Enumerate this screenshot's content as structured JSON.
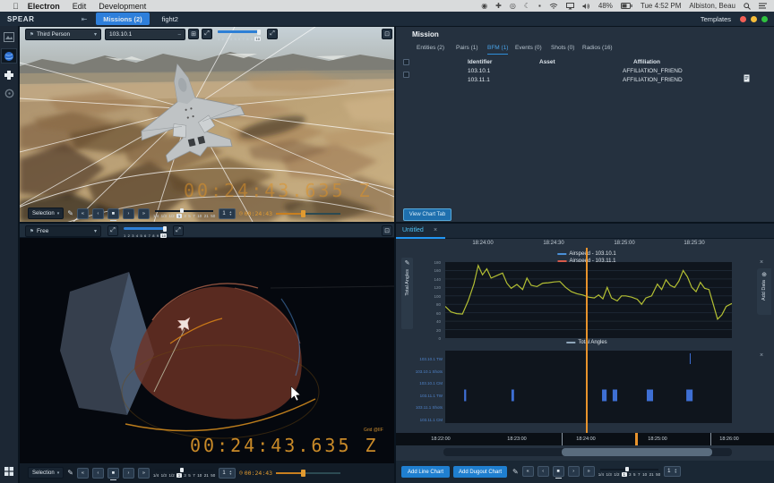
{
  "menubar": {
    "apple_logo": "",
    "menus": [
      "Electron",
      "Edit",
      "Development"
    ],
    "status": {
      "battery": "48%",
      "clock": "Tue 4:52 PM",
      "user": "Albiston, Beau"
    },
    "status_icon_names": [
      "record-icon",
      "ship-icon",
      "globe-icon",
      "moon-icon",
      "lock-icon",
      "wifi-icon",
      "airplay-icon",
      "volume-icon"
    ]
  },
  "toolbar": {
    "app_name": "SPEAR",
    "tabs": [
      {
        "label": "Missions (2)",
        "active": true
      },
      {
        "label": "fight2",
        "active": false
      }
    ],
    "templates_label": "Templates"
  },
  "sidebar": {
    "icons": [
      "scene-icon",
      "globe-3d-icon",
      "dp-logo-icon",
      "ring-icon"
    ],
    "bottom_icon": "layout-grid-icon"
  },
  "viewport_top": {
    "camera_mode": "Third Person",
    "entity": "103.10.1",
    "lod_levels": [
      "1",
      "2",
      "3",
      "4",
      "5",
      "6",
      "7",
      "8",
      "9",
      "10"
    ],
    "lod_selected": "10",
    "timestamp": "00:24:43.635 Z"
  },
  "viewport_bottom": {
    "camera_mode": "Free",
    "lod_levels": [
      "1",
      "2",
      "3",
      "4",
      "5",
      "6",
      "7",
      "8",
      "9",
      "10"
    ],
    "lod_selected": "10",
    "grid_label": "Grid @IIF",
    "timestamp": "00:24:43.635 Z"
  },
  "transport": {
    "selection_label": "Selection",
    "speeds": [
      "1/4",
      "1/3",
      "1/2",
      "1",
      "3",
      "5",
      "7",
      "10",
      "21",
      "50"
    ],
    "speed_selected": "1",
    "stepper_value": "1",
    "time": "00:24:43"
  },
  "mission": {
    "title": "Mission",
    "tabs": [
      {
        "label": "Entities (2)",
        "active": false
      },
      {
        "label": "Pairs (1)",
        "active": false
      },
      {
        "label": "BFM (1)",
        "active": true
      },
      {
        "label": "Events (0)",
        "active": false
      },
      {
        "label": "Shots (0)",
        "active": false
      },
      {
        "label": "Radios (16)",
        "active": false
      }
    ],
    "columns": [
      "Identifier",
      "Asset",
      "Affiliation"
    ],
    "rows": [
      {
        "identifier": "103.10.1",
        "asset": "",
        "affiliation": "AFFILIATION_FRIEND"
      },
      {
        "identifier": "103.11.1",
        "asset": "",
        "affiliation": "AFFILIATION_FRIEND"
      }
    ],
    "view_chart_tab_label": "View Chart Tab"
  },
  "charts": {
    "tab_label": "Untitled",
    "add_data_label": "Add Data",
    "buttons": [
      "Add Line Chart",
      "Add Dugout Chart"
    ],
    "top_time_labels": [
      "18:24:00",
      "18:24:30",
      "18:25:00",
      "18:25:30"
    ],
    "ruler_time_labels": [
      "18:22:00",
      "18:23:00",
      "18:24:00",
      "18:25:00",
      "18:26:00"
    ],
    "legend_top": [
      {
        "label": "Airspeed - 103.10.1",
        "color": "#4a90d8"
      },
      {
        "label": "Airspeed - 103.11.1",
        "color": "#d85a4a"
      }
    ],
    "legend_bottom": {
      "label": "Total Angles",
      "color": "#8fa6ba"
    },
    "y_axis_label": "Total Angles"
  },
  "chart_data": [
    {
      "type": "line",
      "title": "Total Angles",
      "ylabel": "Total Angles",
      "ylim": [
        0,
        180
      ],
      "yticks": [
        0,
        20,
        40,
        60,
        80,
        100,
        120,
        140,
        160,
        180
      ],
      "x_window": [
        "18:23:42",
        "18:25:46"
      ],
      "cursor_time": "18:24:44",
      "cursor_fraction": 0.494,
      "series": [
        {
          "name": "Total Angles",
          "color": "#b3bf33",
          "points": [
            [
              0,
              75
            ],
            [
              0.02,
              62
            ],
            [
              0.04,
              58
            ],
            [
              0.06,
              57
            ],
            [
              0.08,
              88
            ],
            [
              0.1,
              128
            ],
            [
              0.115,
              172
            ],
            [
              0.13,
              150
            ],
            [
              0.145,
              164
            ],
            [
              0.16,
              142
            ],
            [
              0.18,
              148
            ],
            [
              0.2,
              154
            ],
            [
              0.215,
              130
            ],
            [
              0.23,
              118
            ],
            [
              0.25,
              127
            ],
            [
              0.27,
              115
            ],
            [
              0.285,
              142
            ],
            [
              0.3,
              125
            ],
            [
              0.32,
              122
            ],
            [
              0.34,
              130
            ],
            [
              0.36,
              131
            ],
            [
              0.38,
              133
            ],
            [
              0.4,
              134
            ],
            [
              0.42,
              120
            ],
            [
              0.44,
              110
            ],
            [
              0.46,
              105
            ],
            [
              0.48,
              102
            ],
            [
              0.5,
              97
            ],
            [
              0.52,
              95
            ],
            [
              0.535,
              102
            ],
            [
              0.55,
              93
            ],
            [
              0.565,
              120
            ],
            [
              0.58,
              95
            ],
            [
              0.6,
              88
            ],
            [
              0.615,
              100
            ],
            [
              0.63,
              100
            ],
            [
              0.65,
              97
            ],
            [
              0.67,
              92
            ],
            [
              0.685,
              80
            ],
            [
              0.7,
              95
            ],
            [
              0.72,
              100
            ],
            [
              0.74,
              128
            ],
            [
              0.755,
              115
            ],
            [
              0.77,
              138
            ],
            [
              0.785,
              125
            ],
            [
              0.8,
              120
            ],
            [
              0.815,
              135
            ],
            [
              0.83,
              160
            ],
            [
              0.845,
              145
            ],
            [
              0.86,
              120
            ],
            [
              0.875,
              110
            ],
            [
              0.89,
              132
            ],
            [
              0.905,
              118
            ],
            [
              0.92,
              115
            ],
            [
              0.935,
              80
            ],
            [
              0.95,
              45
            ],
            [
              0.965,
              55
            ],
            [
              0.98,
              75
            ],
            [
              1,
              82
            ]
          ]
        }
      ]
    },
    {
      "type": "timeline",
      "rows": [
        "103.10.1 TW",
        "103.10.1 Shots",
        "103.10.1 CM",
        "103.11.1 TW",
        "103.11.1 Shots",
        "103.11.1 CM"
      ],
      "bar_color": "#3e6fd4",
      "x_window": [
        "18:23:42",
        "18:25:46"
      ],
      "events": [
        {
          "row": 3,
          "x": 0.066,
          "w": 0.007
        },
        {
          "row": 3,
          "x": 0.231,
          "w": 0.009
        },
        {
          "row": 3,
          "x": 0.547,
          "w": 0.016
        },
        {
          "row": 3,
          "x": 0.584,
          "w": 0.016
        },
        {
          "row": 3,
          "x": 0.703,
          "w": 0.022
        },
        {
          "row": 0,
          "x": 0.853,
          "w": 0.003
        },
        {
          "row": 3,
          "x": 0.841,
          "w": 0.022
        }
      ]
    }
  ]
}
